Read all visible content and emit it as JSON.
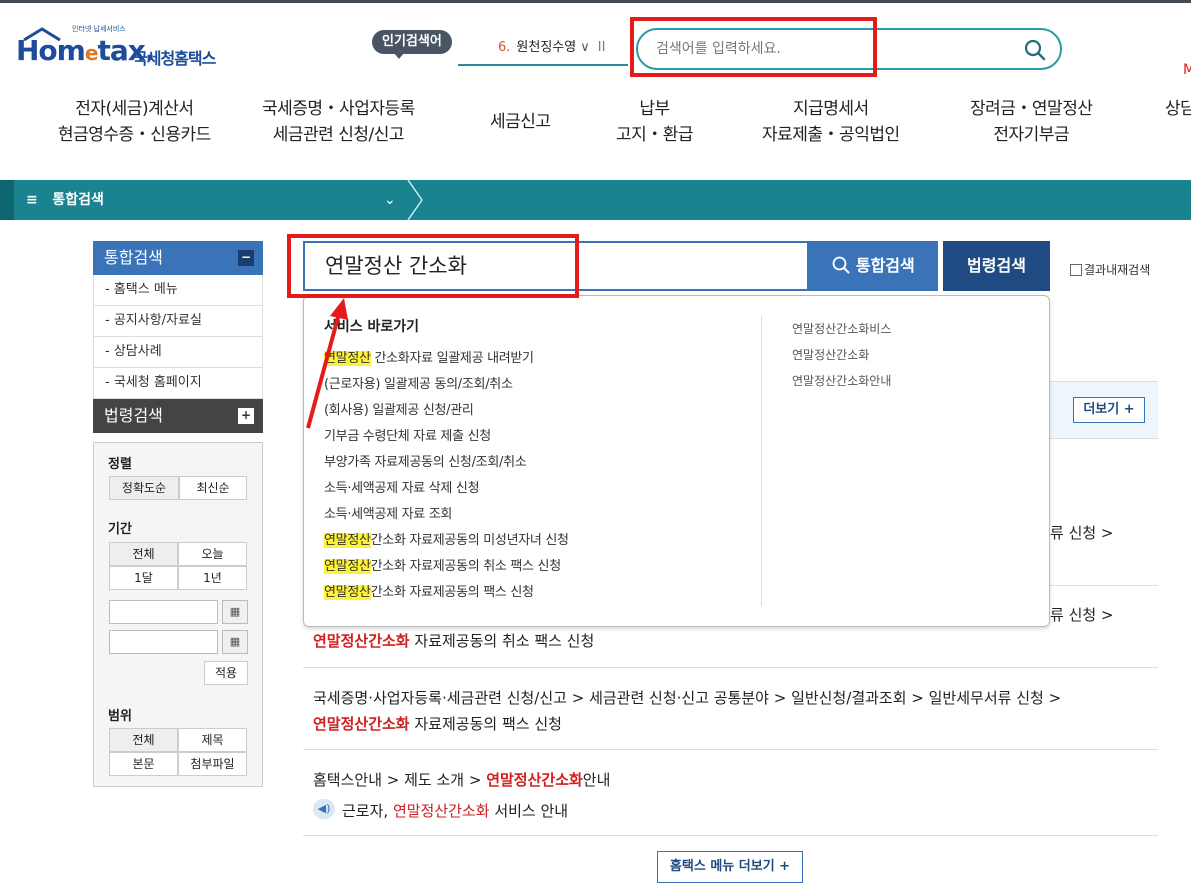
{
  "header": {
    "logo_sub": "인터넷 납세서비스",
    "logo_main_a": "Hom",
    "logo_main_e": "e",
    "logo_main_b": "tax.",
    "logo_kr": "국세청홈택스",
    "popular_label": "인기검색어",
    "rank_num": "6.",
    "rank_text": "원천징수영",
    "search_placeholder": "검색어를 입력하세요.",
    "edge_text": "M"
  },
  "nav": {
    "items": [
      {
        "line1": "전자(세금)계산서",
        "line2": "현금영수증・신용카드"
      },
      {
        "line1": "국세증명・사업자등록",
        "line2": "세금관련 신청/신고"
      },
      {
        "line1": "세금신고",
        "line2": ""
      },
      {
        "line1": "납부",
        "line2": "고지・환급"
      },
      {
        "line1": "지급명세서",
        "line2": "자료제출・공익법인"
      },
      {
        "line1": "장려금・연말정산",
        "line2": "전자기부금"
      },
      {
        "line1": "상담",
        "line2": ""
      }
    ]
  },
  "breadcrumb_bar": {
    "menu_icon": "≡",
    "label": "통합검색"
  },
  "sidebar": {
    "head": "통합검색",
    "head_toggle": "−",
    "items": [
      "- 홈택스 메뉴",
      "- 공지사항/자료실",
      "- 상담사례",
      "- 국세청 홈페이지"
    ],
    "law_head": "법령검색",
    "law_toggle": "+",
    "sort_title": "정렬",
    "sort_options": [
      "정확도순",
      "최신순"
    ],
    "period_title": "기간",
    "period_options": [
      "전체",
      "오늘",
      "1달",
      "1년"
    ],
    "apply": "적용",
    "scope_title": "범위",
    "scope_options": [
      "전체",
      "제목",
      "본문",
      "첨부파일"
    ]
  },
  "search": {
    "query": "연말정산 간소화",
    "total_button": "통합검색",
    "law_button": "법령검색",
    "within_label": "결과내재검색"
  },
  "dropdown": {
    "title": "서비스 바로가기",
    "items": [
      {
        "mark": "연말정산",
        "rest": " 간소화자료 일괄제공 내려받기"
      },
      {
        "mark": "",
        "rest": "(근로자용) 일괄제공 동의/조회/취소"
      },
      {
        "mark": "",
        "rest": "(회사용) 일괄제공 신청/관리"
      },
      {
        "mark": "",
        "rest": "기부금 수령단체 자료 제출 신청"
      },
      {
        "mark": "",
        "rest": "부양가족 자료제공동의 신청/조회/취소"
      },
      {
        "mark": "",
        "rest": "소득·세액공제 자료 삭제 신청"
      },
      {
        "mark": "",
        "rest": "소득·세액공제 자료 조회"
      },
      {
        "mark": "연말정산",
        "rest": "간소화 자료제공동의 미성년자녀 신청"
      },
      {
        "mark": "연말정산",
        "rest": "간소화 자료제공동의 취소 팩스 신청"
      },
      {
        "mark": "연말정산",
        "rest": "간소화 자료제공동의 팩스 신청"
      }
    ],
    "suggestions": [
      "연말정산간소화비스",
      "연말정산간소화",
      "연말정산간소화안내"
    ]
  },
  "results": {
    "more_button": "더보기 +",
    "row1_tail": "류 신청 >",
    "row2_tail": "류 신청 >",
    "row2_hl": "연말정산간소화",
    "row2_rest": " 자료제공동의 취소 팩스 신청",
    "row3_path": "국세증명·사업자등록·세금관련 신청/신고 > 세금관련 신청·신고 공통분야 > 일반신청/결과조회 > 일반세무서류 신청 >",
    "row3_hl": "연말정산간소화",
    "row3_rest": " 자료제공동의 팩스 신청",
    "row4_path": "홈택스안내 > 제도 소개 > ",
    "row4_hl": "연말정산간소화",
    "row4_rest": "안내",
    "row4_sub_a": "근로자, ",
    "row4_sub_hl": "연말정산간소화",
    "row4_sub_b": " 서비스 안내",
    "more_menu": "홈택스 메뉴 더보기 +"
  }
}
